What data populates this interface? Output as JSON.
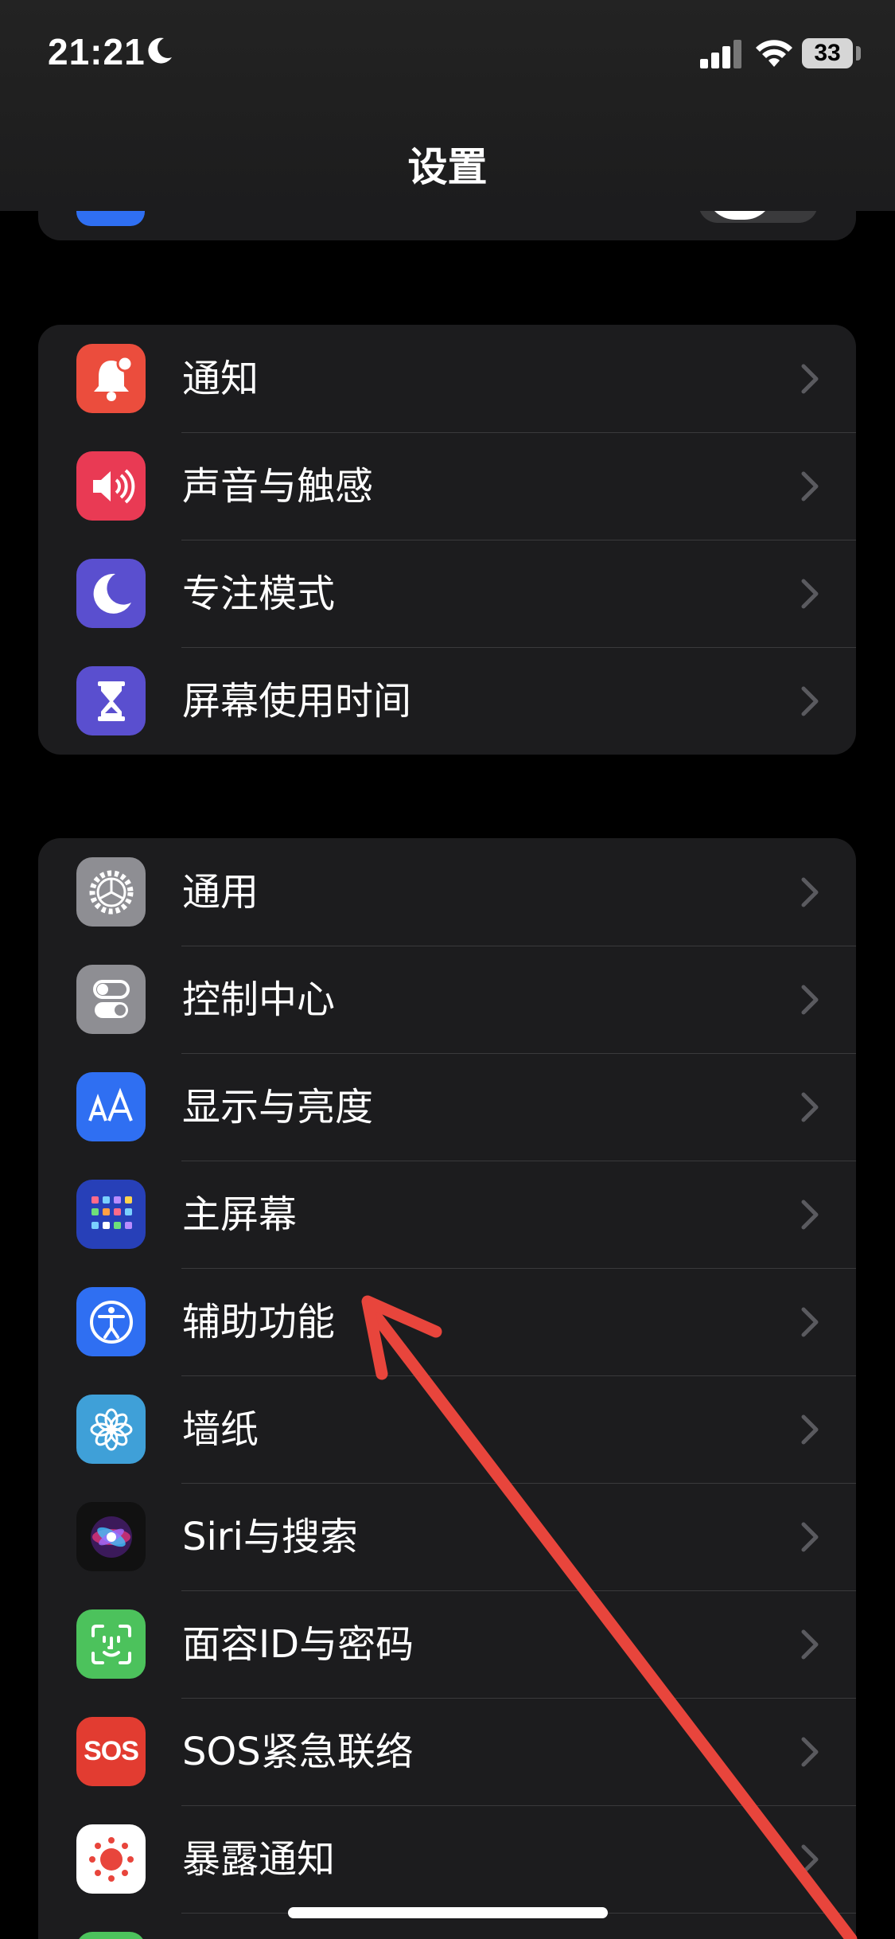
{
  "status_bar": {
    "time": "21:21",
    "battery": "33"
  },
  "nav": {
    "title": "设置"
  },
  "group1": [
    {
      "label": "通知",
      "icon": "bell-icon",
      "color": "#eb4d3d"
    },
    {
      "label": "声音与触感",
      "icon": "speaker-icon",
      "color": "#e93a54"
    },
    {
      "label": "专注模式",
      "icon": "moon-icon",
      "color": "#5a4fcf"
    },
    {
      "label": "屏幕使用时间",
      "icon": "hourglass-icon",
      "color": "#5a4fcf"
    }
  ],
  "group2": [
    {
      "label": "通用",
      "icon": "gear-icon",
      "color": "#8e8e93"
    },
    {
      "label": "控制中心",
      "icon": "toggles-icon",
      "color": "#8e8e93"
    },
    {
      "label": "显示与亮度",
      "icon": "text-size-icon",
      "color": "#2f6ff2"
    },
    {
      "label": "主屏幕",
      "icon": "home-grid-icon",
      "color": "#2740b8"
    },
    {
      "label": "辅助功能",
      "icon": "accessibility-icon",
      "color": "#2f6ff2"
    },
    {
      "label": "墙纸",
      "icon": "flower-icon",
      "color": "#3fa0d8"
    },
    {
      "label": "Siri与搜索",
      "icon": "siri-icon",
      "color": "#111111"
    },
    {
      "label": "面容ID与密码",
      "icon": "face-id-icon",
      "color": "#4cc25c"
    },
    {
      "label": "SOS紧急联络",
      "icon": "sos-icon",
      "color": "#e23c31",
      "icon_text": "SOS"
    },
    {
      "label": "暴露通知",
      "icon": "exposure-icon",
      "color": "#ffffff"
    }
  ],
  "colors": {
    "annotation_arrow": "#e8453c",
    "group_bg": "#1c1c1e",
    "separator": "#3a3a3c"
  }
}
